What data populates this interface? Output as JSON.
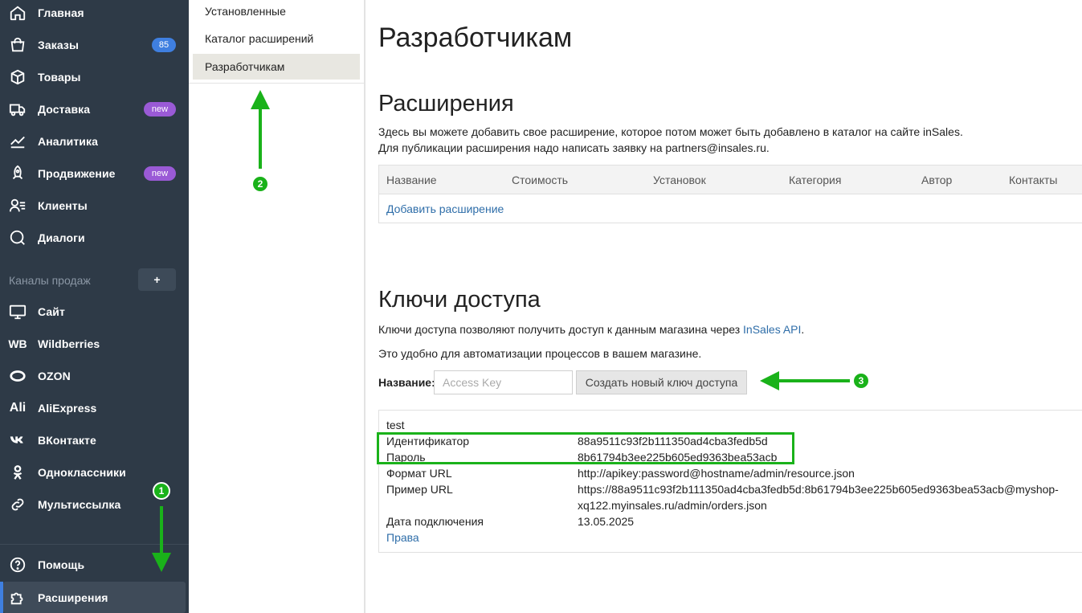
{
  "sidebar": {
    "items": [
      {
        "id": "home",
        "label": "Главная",
        "icon": "home-icon"
      },
      {
        "id": "orders",
        "label": "Заказы",
        "icon": "bag-icon",
        "badge": "85"
      },
      {
        "id": "products",
        "label": "Товары",
        "icon": "box-icon"
      },
      {
        "id": "delivery",
        "label": "Доставка",
        "icon": "truck-icon",
        "badge": "new"
      },
      {
        "id": "analytics",
        "label": "Аналитика",
        "icon": "chart-icon"
      },
      {
        "id": "promotion",
        "label": "Продвижение",
        "icon": "rocket-icon",
        "badge": "new"
      },
      {
        "id": "clients",
        "label": "Клиенты",
        "icon": "users-icon"
      },
      {
        "id": "dialogs",
        "label": "Диалоги",
        "icon": "chat-icon"
      }
    ],
    "channels_label": "Каналы продаж",
    "channels_add": "+",
    "channels": [
      {
        "id": "site",
        "label": "Сайт",
        "icon": "monitor-icon"
      },
      {
        "id": "wb",
        "label": "Wildberries",
        "icon_text": "WB"
      },
      {
        "id": "ozon",
        "label": "OZON",
        "icon": "ozon-icon"
      },
      {
        "id": "ali",
        "label": "AliExpress",
        "icon_text": "Ali"
      },
      {
        "id": "vk",
        "label": "ВКонтакте",
        "icon": "vk-icon"
      },
      {
        "id": "ok",
        "label": "Одноклассники",
        "icon": "ok-icon"
      },
      {
        "id": "multilink",
        "label": "Мультиссылка",
        "icon": "link-icon"
      }
    ],
    "help": "Помощь",
    "extensions": "Расширения"
  },
  "subnav": {
    "items": [
      "Установленные",
      "Каталог расширений",
      "Разработчикам"
    ]
  },
  "main": {
    "title": "Разработчикам",
    "extensions": {
      "heading": "Расширения",
      "desc1": "Здесь вы можете добавить свое расширение, которое потом может быть добавлено в каталог на сайте inSales.",
      "desc2": "Для публикации расширения надо написать заявку на partners@insales.ru.",
      "columns": [
        "Название",
        "Стоимость",
        "Установок",
        "Категория",
        "Автор",
        "Контакты"
      ],
      "add_link": "Добавить расширение"
    },
    "keys": {
      "heading": "Ключи доступа",
      "desc1_pre": "Ключи доступа позволяют получить доступ к данным магазина через ",
      "desc1_link": "InSales API",
      "desc1_post": ".",
      "desc2": "Это удобно для автоматизации процессов в вашем магазине.",
      "name_label": "Название:",
      "name_placeholder": "Access Key",
      "create_button": "Создать новый ключ доступа",
      "key": {
        "name": "test",
        "rows": [
          {
            "label": "Идентификатор",
            "value": "88a9511c93f2b111350ad4cba3fedb5d"
          },
          {
            "label": "Пароль",
            "value": "8b61794b3ee225b605ed9363bea53acb"
          },
          {
            "label": "Формат URL",
            "value": "http://apikey:password@hostname/admin/resource.json"
          },
          {
            "label": "Пример URL",
            "value": "https://88a9511c93f2b111350ad4cba3fedb5d:8b61794b3ee225b605ed9363bea53acb@myshop-",
            "value2": "xq122.myinsales.ru/admin/orders.json"
          },
          {
            "label": "Дата подключения",
            "value": "13.05.2025"
          }
        ],
        "rights_link": "Права"
      }
    }
  },
  "annotations": [
    "1",
    "2",
    "3"
  ],
  "colors": {
    "sidebar": "#2e3a47",
    "accent_green": "#1ab21a",
    "link": "#2f6ea9",
    "badge_blue": "#3f7fe0",
    "badge_purple": "#9a5ad6"
  }
}
